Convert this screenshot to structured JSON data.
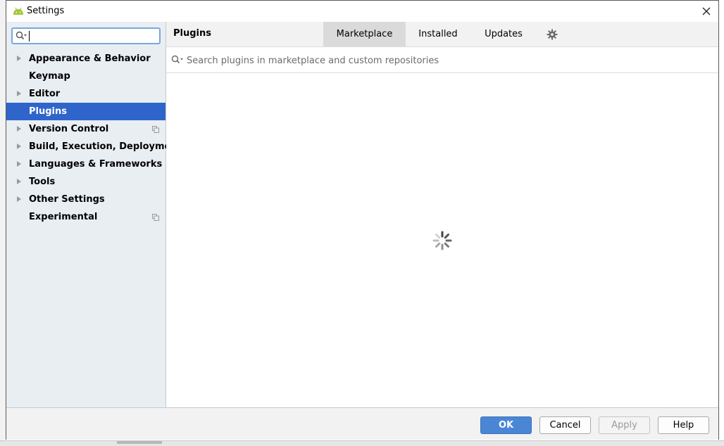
{
  "window": {
    "title": "Settings"
  },
  "sidebar": {
    "search": {
      "value": "",
      "placeholder": ""
    },
    "items": [
      {
        "label": "Appearance & Behavior",
        "expandable": true,
        "selected": false,
        "project_icon": false
      },
      {
        "label": "Keymap",
        "expandable": false,
        "selected": false,
        "project_icon": false
      },
      {
        "label": "Editor",
        "expandable": true,
        "selected": false,
        "project_icon": false
      },
      {
        "label": "Plugins",
        "expandable": false,
        "selected": true,
        "project_icon": false
      },
      {
        "label": "Version Control",
        "expandable": true,
        "selected": false,
        "project_icon": true
      },
      {
        "label": "Build, Execution, Deployment",
        "expandable": true,
        "selected": false,
        "project_icon": false
      },
      {
        "label": "Languages & Frameworks",
        "expandable": true,
        "selected": false,
        "project_icon": false
      },
      {
        "label": "Tools",
        "expandable": true,
        "selected": false,
        "project_icon": false
      },
      {
        "label": "Other Settings",
        "expandable": true,
        "selected": false,
        "project_icon": false
      },
      {
        "label": "Experimental",
        "expandable": false,
        "selected": false,
        "project_icon": true
      }
    ]
  },
  "content": {
    "title": "Plugins",
    "tabs": [
      {
        "label": "Marketplace",
        "active": true
      },
      {
        "label": "Installed",
        "active": false
      },
      {
        "label": "Updates",
        "active": false
      }
    ],
    "search": {
      "value": "",
      "placeholder": "Search plugins in marketplace and custom repositories"
    },
    "loading": true
  },
  "footer": {
    "ok_label": "OK",
    "cancel_label": "Cancel",
    "apply_label": "Apply",
    "help_label": "Help"
  },
  "colors": {
    "selection": "#2f65ca",
    "primary_button": "#4a86d4",
    "sidebar_bg": "#e9eef3",
    "search_focus": "#7aa7de",
    "android_green": "#a4c639"
  },
  "icons": {
    "title": "android-icon",
    "close": "close-icon",
    "search": "search-icon",
    "settings": "gear-icon",
    "loading": "spinner-icon",
    "expand": "chevron-right-icon",
    "project": "project-level-icon"
  }
}
